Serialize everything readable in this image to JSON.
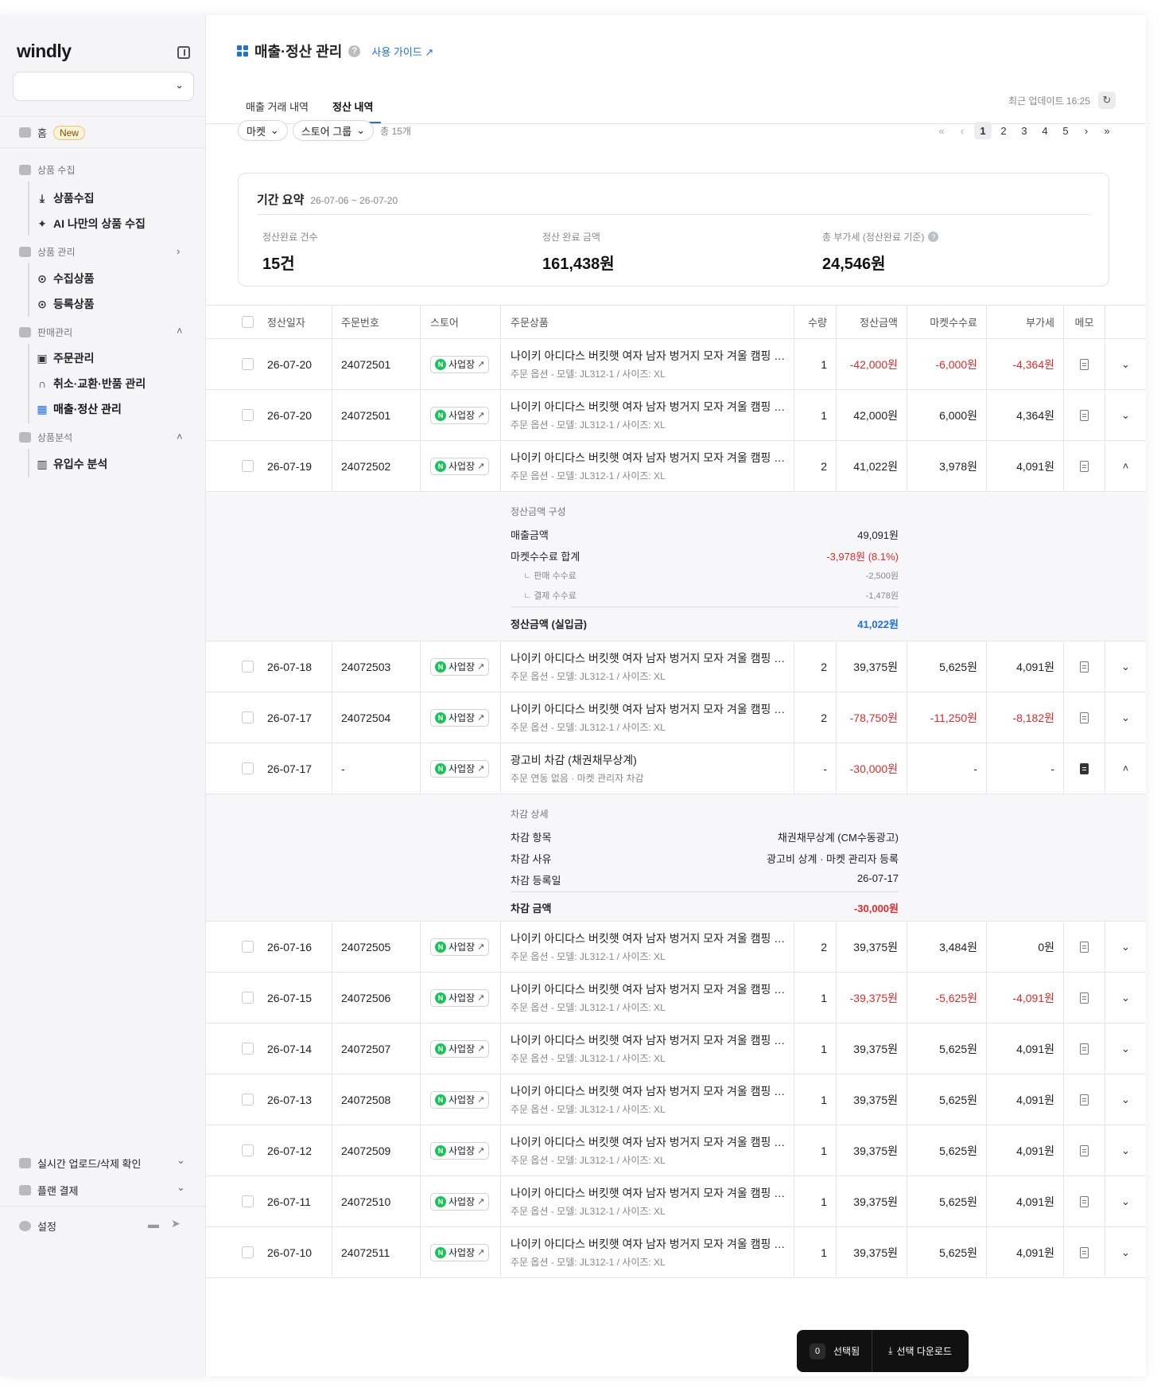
{
  "app": {
    "logo": "windly"
  },
  "sidebar": {
    "home": {
      "label": "홈",
      "badge": "New"
    },
    "groups": [
      {
        "label": "상품 수집",
        "items": [
          "상품수집",
          "AI 나만의 상품 수집"
        ]
      },
      {
        "label": "상품 관리",
        "items": [
          "수집상품",
          "등록상품"
        ]
      },
      {
        "label": "판매관리",
        "items": [
          "주문관리",
          "취소·교환·반품 관리",
          "매출·정산 관리"
        ]
      },
      {
        "label": "상품분석",
        "items": [
          "유입수 분석"
        ]
      }
    ],
    "bottom": [
      "실시간 업로드/삭제 확인",
      "플랜 결제"
    ],
    "settings": "설정"
  },
  "page": {
    "title": "매출·정산 관리",
    "guide": "사용 가이드",
    "tabs": [
      "매출 거래 내역",
      "정산 내역"
    ],
    "update_label": "최근 업데이트 16:25",
    "filters": {
      "market": "마켓",
      "store_group": "스토어 그룹",
      "total": "총 15개"
    },
    "pager": [
      "1",
      "2",
      "3",
      "4",
      "5"
    ]
  },
  "summary": {
    "title": "기간 요약",
    "range": "26-07-06 ~ 26-07-20",
    "stats": [
      {
        "label": "정산완료 건수",
        "value": "15건"
      },
      {
        "label": "정산 완료 금액",
        "value": "161,438원"
      },
      {
        "label": "총 부가세 (정산완료 기준)",
        "value": "24,546원"
      }
    ]
  },
  "table": {
    "headers": [
      "정산일자",
      "주문번호",
      "스토어",
      "주문상품",
      "수량",
      "정산금액",
      "마켓수수료",
      "부가세",
      "메모"
    ],
    "store_label": "사업장",
    "product_name": "나이키 아디다스 버킷햇 여자 남자 벙거지 모자 겨울 캠핑 서핑모자 벙거지모자",
    "product_option": "주문 옵션 - 모델: JL312-1 / 사이즈: XL",
    "rows": [
      {
        "date": "26-07-20",
        "order": "24072501",
        "qty": "1",
        "amount": "-42,000원",
        "fee": "-6,000원",
        "vat": "-4,364원"
      },
      {
        "date": "26-07-20",
        "order": "24072501",
        "qty": "1",
        "amount": "42,000원",
        "fee": "6,000원",
        "vat": "4,364원"
      },
      {
        "date": "26-07-19",
        "order": "24072502",
        "qty": "2",
        "amount": "41,022원",
        "fee": "3,978원",
        "vat": "4,091원"
      },
      {
        "date": "26-07-18",
        "order": "24072503",
        "qty": "2",
        "amount": "39,375원",
        "fee": "5,625원",
        "vat": "4,091원"
      },
      {
        "date": "26-07-17",
        "order": "24072504",
        "qty": "2",
        "amount": "-78,750원",
        "fee": "-11,250원",
        "vat": "-8,182원"
      },
      {
        "date": "26-07-17",
        "order": "-",
        "qty": "-",
        "amount": "-30,000원",
        "fee": "-",
        "vat": "-",
        "name": "광고비 차감 (채권채무상계)",
        "option": "주문 연동 없음 · 마켓 관리자 차감"
      },
      {
        "date": "26-07-16",
        "order": "24072505",
        "qty": "2",
        "amount": "39,375원",
        "fee": "3,484원",
        "vat": "0원"
      },
      {
        "date": "26-07-15",
        "order": "24072506",
        "qty": "1",
        "amount": "-39,375원",
        "fee": "-5,625원",
        "vat": "-4,091원"
      },
      {
        "date": "26-07-14",
        "order": "24072507",
        "qty": "1",
        "amount": "39,375원",
        "fee": "5,625원",
        "vat": "4,091원"
      },
      {
        "date": "26-07-13",
        "order": "24072508",
        "qty": "1",
        "amount": "39,375원",
        "fee": "5,625원",
        "vat": "4,091원"
      },
      {
        "date": "26-07-12",
        "order": "24072509",
        "qty": "1",
        "amount": "39,375원",
        "fee": "5,625원",
        "vat": "4,091원"
      },
      {
        "date": "26-07-11",
        "order": "24072510",
        "qty": "1",
        "amount": "39,375원",
        "fee": "5,625원",
        "vat": "4,091원"
      },
      {
        "date": "26-07-10",
        "order": "24072511",
        "qty": "1",
        "amount": "39,375원",
        "fee": "5,625원",
        "vat": "4,091원"
      }
    ],
    "expand_settle": {
      "title": "정산금액 구성",
      "sales_label": "매출금액",
      "sales": "49,091원",
      "fee_label": "마켓수수료 합계",
      "fee": "-3,978원 (8.1%)",
      "sell_fee_label": "판매 수수료",
      "sell_fee": "-2,500원",
      "pay_fee_label": "결제 수수료",
      "pay_fee": "-1,478원",
      "net_label": "정산금액 (실입금)",
      "net": "41,022원"
    },
    "expand_deduct": {
      "title": "차감 상세",
      "item_label": "차감 항목",
      "item": "채권채무상계 (CM수동광고)",
      "reason_label": "차감 사유",
      "reason": "광고비 상계 · 마켓 관리자 등록",
      "date_label": "차감 등록일",
      "date": "26-07-17",
      "amount_label": "차감 금액",
      "amount": "-30,000원"
    }
  },
  "fab": {
    "count": "0",
    "selected": "선택됨",
    "download": "선택 다운로드"
  }
}
